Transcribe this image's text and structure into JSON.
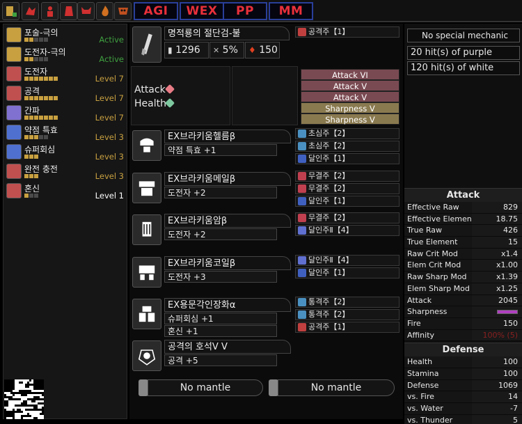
{
  "topbar": {
    "icon_names": [
      "loadout-icon",
      "fire-monster-icon",
      "hunter-icon",
      "barrel-icon",
      "demon-icon",
      "flame-icon",
      "mask-icon"
    ],
    "buttons": [
      "AGI",
      "WEX",
      "PP",
      "MM"
    ]
  },
  "skills": [
    {
      "name": "포술-극의",
      "pips": [
        1,
        1,
        0,
        0,
        0
      ],
      "level": "Active",
      "level_color": "#3fa040",
      "icon_color": "#c8a040"
    },
    {
      "name": "도전자-극의",
      "pips": [
        1,
        1,
        0,
        0,
        0
      ],
      "level": "Active",
      "level_color": "#3fa040",
      "icon_color": "#c8a040"
    },
    {
      "name": "도전자",
      "pips": [
        1,
        1,
        1,
        1,
        1,
        1,
        1
      ],
      "level": "Level 7",
      "level_color": "#c8a040",
      "icon_color": "#c05050"
    },
    {
      "name": "공격",
      "pips": [
        1,
        1,
        1,
        1,
        1,
        1,
        1
      ],
      "level": "Level 7",
      "level_color": "#c8a040",
      "icon_color": "#c05050"
    },
    {
      "name": "간파",
      "pips": [
        1,
        1,
        1,
        1,
        1,
        1,
        1
      ],
      "level": "Level 7",
      "level_color": "#c8a040",
      "icon_color": "#8070d0"
    },
    {
      "name": "약점 특효",
      "pips": [
        1,
        1,
        1,
        0,
        0
      ],
      "level": "Level 3",
      "level_color": "#c8a040",
      "icon_color": "#5070d0"
    },
    {
      "name": "슈퍼회심",
      "pips": [
        1,
        1,
        1
      ],
      "level": "Level 3",
      "level_color": "#c8a040",
      "icon_color": "#5070d0"
    },
    {
      "name": "완전 충전",
      "pips": [
        1,
        1,
        1
      ],
      "level": "Level 3",
      "level_color": "#c8a040",
      "icon_color": "#c05050"
    },
    {
      "name": "혼신",
      "pips": [
        1,
        0,
        0
      ],
      "level": "Level 1",
      "level_color": "#ffffff",
      "icon_color": "#c05050"
    }
  ],
  "weapon": {
    "name": "명적룡의 절단검-불",
    "attack": "1296",
    "affinity": "5%",
    "element": "150",
    "deco": "공격주【1】",
    "deco_color": "#c04040",
    "icon": "charge-blade-icon"
  },
  "ramp": {
    "labels": [
      "Attack",
      "Health"
    ],
    "colors": [
      "#e87c86",
      "#7ec8a0"
    ],
    "bonuses": [
      {
        "label": "Attack VI",
        "color": "#7a4a52"
      },
      {
        "label": "Attack V",
        "color": "#7a4a52"
      },
      {
        "label": "Attack V",
        "color": "#7a4a52"
      },
      {
        "label": "Sharpness V",
        "color": "#8a7a50"
      },
      {
        "label": "Sharpness V",
        "color": "#8a7a50"
      }
    ]
  },
  "armor": [
    {
      "name": "EX브라키움헬름β",
      "skills": [
        "약점 특효 +1"
      ],
      "icon": "helmet-icon",
      "decos": [
        {
          "t": "초심주【2】",
          "c": "#4a90c0"
        },
        {
          "t": "초심주【2】",
          "c": "#4a90c0"
        },
        {
          "t": "달인주【1】",
          "c": "#4060c0"
        }
      ]
    },
    {
      "name": "EX브라키움메일β",
      "skills": [
        "도전자 +2"
      ],
      "icon": "chest-icon",
      "decos": [
        {
          "t": "무결주【2】",
          "c": "#c04050"
        },
        {
          "t": "무결주【2】",
          "c": "#c04050"
        },
        {
          "t": "달인주【1】",
          "c": "#4060c0"
        }
      ]
    },
    {
      "name": "EX브라키움암β",
      "skills": [
        "도전자 +2"
      ],
      "icon": "arms-icon",
      "decos": [
        {
          "t": "무결주【2】",
          "c": "#c04050"
        },
        {
          "t": "달인주Ⅱ【4】",
          "c": "#6070d0"
        }
      ]
    },
    {
      "name": "EX브라키움코일β",
      "skills": [
        "도전자 +3"
      ],
      "icon": "waist-icon",
      "decos": [
        {
          "t": "달인주Ⅱ【4】",
          "c": "#6070d0"
        },
        {
          "t": "달인주【1】",
          "c": "#4060c0"
        }
      ]
    },
    {
      "name": "EX용문각인장화α",
      "skills": [
        "슈퍼회심 +1",
        "혼신 +1"
      ],
      "icon": "legs-icon",
      "decos": [
        {
          "t": "통격주【2】",
          "c": "#4a90c0"
        },
        {
          "t": "통격주【2】",
          "c": "#4a90c0"
        },
        {
          "t": "공격주【1】",
          "c": "#c04040"
        }
      ]
    },
    {
      "name": "공격의 호석Ⅴ Ⅴ",
      "skills": [
        "공격 +5"
      ],
      "icon": "talisman-icon",
      "decos": []
    }
  ],
  "right": {
    "mechanic": "No special mechanic",
    "hits": [
      "20 hit(s) of purple",
      "120 hit(s) of white"
    ]
  },
  "attack_stats": {
    "title": "Attack",
    "rows": [
      [
        "Effective Raw",
        "829"
      ],
      [
        "Effective Element",
        "18.75"
      ],
      [
        "True Raw",
        "426"
      ],
      [
        "True Element",
        "15"
      ],
      [
        "Raw Crit Mod",
        "x1.4"
      ],
      [
        "Elem Crit Mod",
        "x1.00"
      ],
      [
        "Raw Sharp Mod",
        "x1.39"
      ],
      [
        "Elem Sharp Mod",
        "x1.25"
      ],
      [
        "Attack",
        "2045"
      ],
      [
        "Sharpness",
        ""
      ],
      [
        "Fire",
        "150"
      ],
      [
        "Affinity",
        "100% (5)"
      ]
    ]
  },
  "defense_stats": {
    "title": "Defense",
    "rows": [
      [
        "Health",
        "100"
      ],
      [
        "Stamina",
        "100"
      ],
      [
        "Defense",
        "1069"
      ],
      [
        "vs. Fire",
        "14"
      ],
      [
        "vs. Water",
        "-7"
      ],
      [
        "vs. Thunder",
        "5"
      ]
    ]
  },
  "mantles": [
    "No mantle",
    "No mantle"
  ],
  "colors": {
    "accent": "#e8303a",
    "button_border": "#2a3f9a",
    "gold": "#c8a040",
    "active": "#3fa040"
  }
}
